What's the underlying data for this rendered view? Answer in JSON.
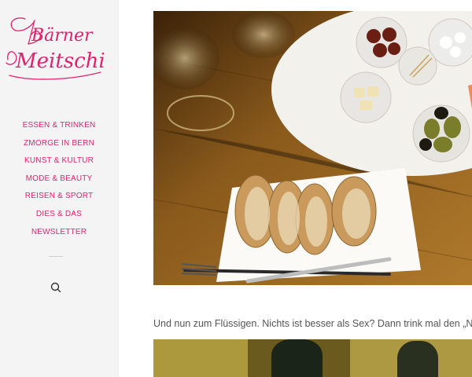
{
  "logo": {
    "line1": "Bärner",
    "line2": "Meitschi",
    "color": "#e0236f"
  },
  "nav": {
    "items": [
      {
        "label": "ESSEN & TRINKEN"
      },
      {
        "label": "ZMORGE IN BERN"
      },
      {
        "label": "KUNST & KULTUR"
      },
      {
        "label": "MODE & BEAUTY"
      },
      {
        "label": "REISEN & SPORT"
      },
      {
        "label": "DIES & DAS"
      },
      {
        "label": "NEWSLETTER"
      }
    ]
  },
  "search": {
    "icon": "search-icon"
  },
  "article": {
    "caption": "Und nun zum Flüssigen. Nichts ist besser als Sex? Dann trink mal den „No-Se"
  },
  "colors": {
    "accent": "#e0236f",
    "sidebar_bg": "#f4f4f4",
    "text": "#555555"
  }
}
